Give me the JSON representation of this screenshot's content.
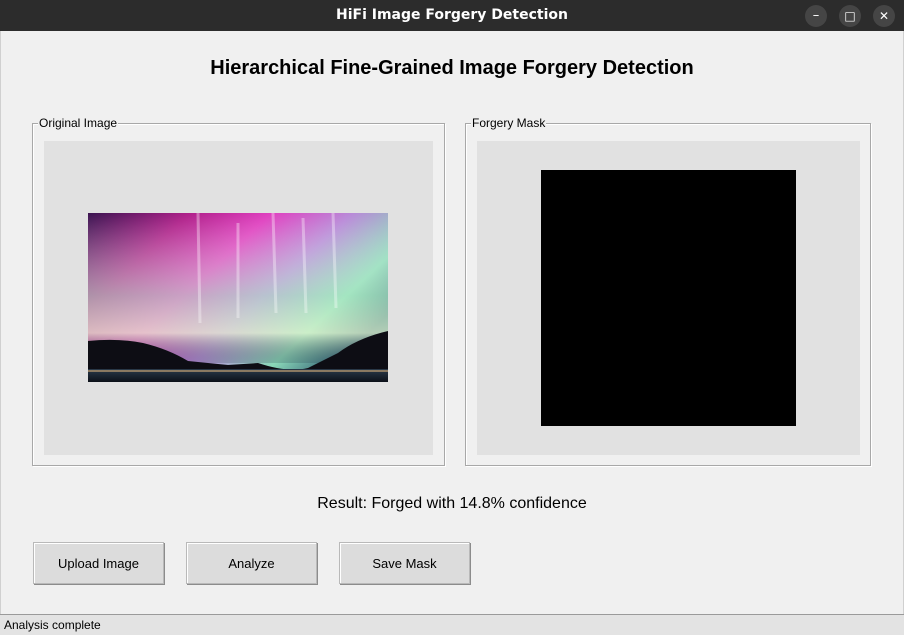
{
  "window": {
    "title": "HiFi Image Forgery Detection",
    "controls": {
      "minimize": "–",
      "maximize": "□",
      "close": "✕"
    }
  },
  "heading": "Hierarchical Fine-Grained Image Forgery Detection",
  "panels": {
    "original": {
      "label": "Original Image"
    },
    "mask": {
      "label": "Forgery Mask"
    }
  },
  "result": "Result: Forged with 14.8% confidence",
  "buttons": {
    "upload": "Upload Image",
    "analyze": "Analyze",
    "save_mask": "Save Mask"
  },
  "status": "Analysis complete",
  "colors": {
    "titlebar": "#2c2c2c",
    "window_bg": "#f0f0f0",
    "canvas_bg": "#e1e1e1",
    "mask": "#000000"
  }
}
